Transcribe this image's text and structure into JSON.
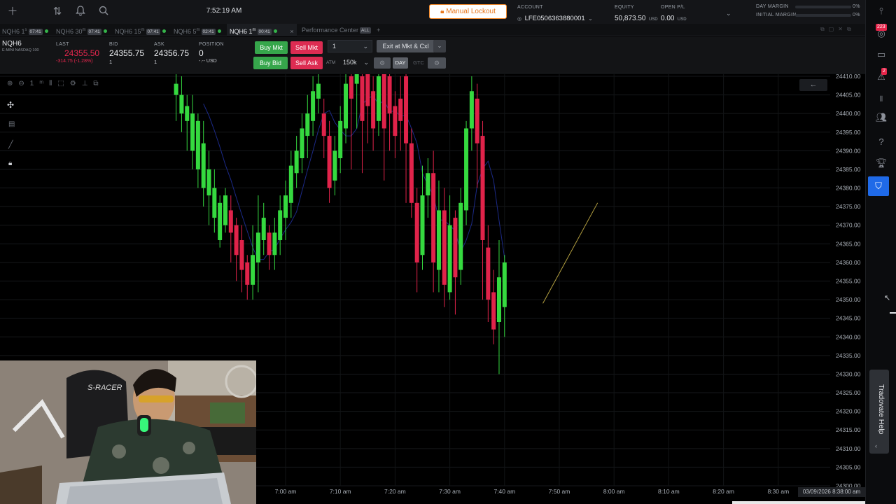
{
  "topbar": {
    "clock": "7:52:19 AM",
    "manual_lockout": "Manual Lockout",
    "account_label": "ACCOUNT",
    "account_value": "LFE0506363880001",
    "equity_label": "EQUITY",
    "equity_value": "50,873.50",
    "equity_unit": "USD",
    "openpl_label": "OPEN P/L",
    "openpl_value": "0.00",
    "openpl_unit": "USD",
    "day_margin_label": "DAY MARGIN",
    "day_margin_pct": "0%",
    "initial_margin_label": "INITIAL MARGIN",
    "initial_margin_pct": "0%"
  },
  "tabs": [
    {
      "name": "NQH6 1",
      "sup": "s",
      "time": "07:41"
    },
    {
      "name": "NQH6 30",
      "sup": "m",
      "time": "07:41"
    },
    {
      "name": "NQH6 15",
      "sup": "m",
      "time": "07:41"
    },
    {
      "name": "NQH6 5",
      "sup": "m",
      "time": "02:41"
    },
    {
      "name": "NQH6 1",
      "sup": "m",
      "time": "00:41"
    },
    {
      "name": "Performance Center",
      "sup": "",
      "time": "ALL"
    }
  ],
  "instrument": {
    "symbol": "NQH6",
    "description": "E-MINI NASDAQ 100",
    "last_label": "LAST",
    "last": "24355.50",
    "change": "-314.75 (-1.28%)",
    "bid_label": "BID",
    "bid": "24355.75",
    "bid_size": "1",
    "ask_label": "ASK",
    "ask": "24356.75",
    "ask_size": "1",
    "position_label": "POSITION",
    "position": "0",
    "position_pl": "-.-- USD"
  },
  "order": {
    "buy_mkt": "Buy Mkt",
    "sell_mkt": "Sell Mkt",
    "buy_bid": "Buy Bid",
    "sell_ask": "Sell Ask",
    "qty": "1",
    "atm_label": "ATM",
    "atm_value": "150k",
    "exit_label": "Exit at Mkt & Cxl",
    "tif_day": "DAY",
    "tif_gtc": "GTC"
  },
  "chart_data": {
    "type": "candlestick",
    "y_labels": [
      "24410.00",
      "24405.00",
      "24400.00",
      "24395.00",
      "24390.00",
      "24385.00",
      "24380.00",
      "24375.00",
      "24370.00",
      "24365.00",
      "24360.00",
      "24355.00",
      "24350.00",
      "24345.00",
      "24340.00",
      "24335.00",
      "24330.00",
      "24325.00",
      "24320.00",
      "24315.00",
      "24310.00",
      "24305.00",
      "24300.00"
    ],
    "x_labels": [
      "7:00 am",
      "7:10 am",
      "7:20 am",
      "7:30 am",
      "7:40 am",
      "7:50 am",
      "8:00 am",
      "8:10 am",
      "8:20 am",
      "8:30 am"
    ],
    "cursor_time": "03/09/2026 8:38:00 am",
    "ylim": [
      24300,
      24410
    ],
    "up_color": "#35d93f",
    "down_color": "#e0234a",
    "candles": [
      [
        24405,
        24408,
        24398,
        24412
      ],
      [
        24400,
        24405,
        24395,
        24410
      ],
      [
        24398,
        24402,
        24390,
        24405
      ],
      [
        24390,
        24400,
        24385,
        24405
      ],
      [
        24385,
        24398,
        24380,
        24400
      ],
      [
        24380,
        24392,
        24375,
        24398
      ],
      [
        24378,
        24385,
        24370,
        24390
      ],
      [
        24372,
        24380,
        24368,
        24385
      ],
      [
        24366,
        24376,
        24364,
        24378
      ],
      [
        24370,
        24378,
        24368,
        24380
      ],
      [
        24374,
        24368,
        24360,
        24378
      ],
      [
        24370,
        24362,
        24355,
        24372
      ],
      [
        24366,
        24358,
        24352,
        24370
      ],
      [
        24360,
        24354,
        24350,
        24362
      ],
      [
        24354,
        24362,
        24350,
        24370
      ],
      [
        24360,
        24368,
        24352,
        24378
      ],
      [
        24366,
        24372,
        24362,
        24376
      ],
      [
        24368,
        24362,
        24358,
        24370
      ],
      [
        24362,
        24368,
        24358,
        24372
      ],
      [
        24366,
        24374,
        24362,
        24378
      ],
      [
        24372,
        24378,
        24366,
        24382
      ],
      [
        24376,
        24386,
        24372,
        24390
      ],
      [
        24384,
        24390,
        24380,
        24394
      ],
      [
        24388,
        24396,
        24384,
        24400
      ],
      [
        24394,
        24400,
        24388,
        24405
      ],
      [
        24398,
        24406,
        24394,
        24410
      ],
      [
        24404,
        24408,
        24400,
        24412
      ],
      [
        24400,
        24394,
        24388,
        24404
      ],
      [
        24394,
        24380,
        24376,
        24398
      ],
      [
        24382,
        24390,
        24378,
        24394
      ],
      [
        24388,
        24398,
        24384,
        24402
      ],
      [
        24396,
        24408,
        24392,
        24412
      ],
      [
        24410,
        24404,
        24385,
        24412
      ],
      [
        24408,
        24412,
        24396,
        24414
      ],
      [
        24410,
        24398,
        24384,
        24412
      ],
      [
        24412,
        24402,
        24392,
        24414
      ],
      [
        24406,
        24396,
        24390,
        24410
      ],
      [
        24398,
        24410,
        24394,
        24412
      ],
      [
        24412,
        24396,
        24382,
        24414
      ],
      [
        24410,
        24400,
        24390,
        24412
      ],
      [
        24402,
        24394,
        24388,
        24406
      ],
      [
        24404,
        24398,
        24390,
        24410
      ],
      [
        24410,
        24392,
        24376,
        24412
      ],
      [
        24392,
        24376,
        24372,
        24396
      ],
      [
        24376,
        24360,
        24352,
        24380
      ],
      [
        24362,
        24378,
        24358,
        24386
      ],
      [
        24378,
        24384,
        24372,
        24388
      ],
      [
        24384,
        24360,
        24352,
        24390
      ],
      [
        24358,
        24374,
        24352,
        24382
      ],
      [
        24374,
        24354,
        24348,
        24380
      ],
      [
        24352,
        24370,
        24350,
        24378
      ],
      [
        24372,
        24356,
        24346,
        24374
      ],
      [
        24358,
        24376,
        24354,
        24380
      ],
      [
        24374,
        24396,
        24370,
        24398
      ],
      [
        24396,
        24406,
        24390,
        24410
      ],
      [
        24404,
        24392,
        24380,
        24408
      ],
      [
        24394,
        24366,
        24350,
        24398
      ],
      [
        24364,
        24350,
        24344,
        24370
      ],
      [
        24352,
        24342,
        24338,
        24358
      ],
      [
        24344,
        24356,
        24330,
        24366
      ],
      [
        24348,
        24360,
        24340,
        24362
      ]
    ],
    "trendline": {
      "x": [
        "7:47 am",
        "7:57 am"
      ],
      "y": [
        24349,
        24376
      ]
    }
  },
  "sidebar": {
    "notif_count": "223",
    "alert_count": "2",
    "help_label": "Tradovate Help"
  },
  "icons": [
    "add-icon",
    "transfer-icon",
    "bell-icon",
    "search-icon",
    "lock-icon",
    "chevron-down-icon",
    "settings-sliders-icon",
    "crosshair-icon",
    "note-icon",
    "pencil-icon",
    "chat-icon",
    "warning-icon",
    "trophy-icon",
    "shield-icon",
    "help-icon",
    "users-icon",
    "back-arrow-icon"
  ]
}
